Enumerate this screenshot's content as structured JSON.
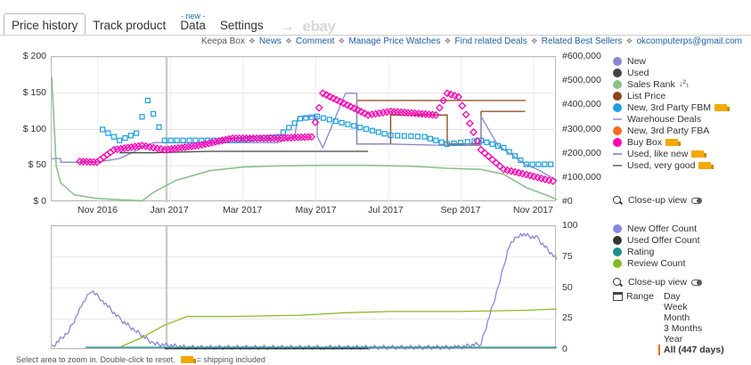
{
  "tabs": {
    "price_history": "Price history",
    "track_product": "Track product",
    "data_badge": "- new -",
    "data": "Data",
    "settings": "Settings",
    "arrow": "→",
    "ebay": "ebay"
  },
  "links": {
    "keepa_box": "Keepa Box",
    "news": "News",
    "comment": "Comment",
    "manage": "Manage Price Watches",
    "deals": "Find related Deals",
    "sellers": "Related Best Sellers",
    "email": "okcomputerps@gmail.com",
    "separator": "❖"
  },
  "top_legend": {
    "new": "New",
    "used": "Used",
    "sales_rank": "Sales Rank",
    "list_price": "List Price",
    "fbm": "New, 3rd Party FBM",
    "warehouse": "Warehouse Deals",
    "fba": "New, 3rd Party FBA",
    "buybox": "Buy Box",
    "like_new": "Used, like new",
    "very_good": "Used, very good",
    "sort_icon": "↓²₁",
    "closeup": "Close-up view"
  },
  "bottom_legend": {
    "new_offer": "New Offer Count",
    "used_offer": "Used Offer Count",
    "rating": "Rating",
    "review": "Review Count",
    "closeup": "Close-up view"
  },
  "range": {
    "label": "Range",
    "options": [
      "Day",
      "Week",
      "Month",
      "3 Months",
      "Year",
      "All (447 days)"
    ]
  },
  "footer": {
    "hint": "Select area to zoom in. Double-click to reset.",
    "shipping": "= shipping included"
  },
  "colors": {
    "new": "#8888cc",
    "used": "#444444",
    "sales_rank": "#8dc08d",
    "list_price": "#8b4513",
    "fbm": "#1a9fe0",
    "warehouse": "#b0a8e0",
    "fba": "#ff6a1a",
    "buybox": "#ff00b4",
    "like_new": "#9a9ad0",
    "very_good": "#888888",
    "new_offer": "#8888dd",
    "used_offer": "#333333",
    "rating": "#1a8f8f",
    "review": "#88bb22"
  },
  "chart_data": [
    {
      "type": "line",
      "title": "",
      "x_ticks": [
        "Nov 2016",
        "Jan 2017",
        "Mar 2017",
        "May 2017",
        "Jul 2017",
        "Sep 2017",
        "Nov 2017"
      ],
      "y_left_ticks": [
        "$ 200",
        "$ 150",
        "$ 100",
        "$ 50",
        "$ 0"
      ],
      "y_right_ticks": [
        "#600,000",
        "#500,000",
        "#400,000",
        "#300,000",
        "#200,000",
        "#100,000",
        "#0"
      ],
      "ylim_left": [
        0,
        200
      ],
      "ylim_right": [
        0,
        600000
      ],
      "x_domain_days": [
        0,
        447
      ],
      "series": [
        {
          "name": "List Price",
          "points": [
            [
              270,
              140
            ],
            [
              419,
              140
            ],
            [
              270,
              140
            ],
            [
              270,
              80
            ],
            [
              300,
              80
            ],
            [
              300,
              120
            ],
            [
              350,
              120
            ],
            [
              350,
              80
            ],
            [
              380,
              80
            ],
            [
              380,
              125
            ],
            [
              419,
              125
            ]
          ]
        },
        {
          "name": "New",
          "points": [
            [
              0,
              60
            ],
            [
              8,
              60
            ],
            [
              8,
              55
            ],
            [
              40,
              55
            ],
            [
              60,
              60
            ],
            [
              90,
              82
            ],
            [
              140,
              82
            ],
            [
              180,
              82
            ],
            [
              200,
              82
            ],
            [
              215,
              90
            ],
            [
              218,
              118
            ],
            [
              235,
              118
            ],
            [
              235,
              90
            ],
            [
              240,
              75
            ],
            [
              260,
              150
            ],
            [
              270,
              150
            ],
            [
              270,
              80
            ],
            [
              300,
              80
            ],
            [
              300,
              80
            ],
            [
              350,
              78
            ],
            [
              380,
              78
            ],
            [
              380,
              118
            ],
            [
              395,
              78
            ],
            [
              410,
              62
            ],
            [
              419,
              52
            ],
            [
              430,
              45
            ],
            [
              447,
              30
            ]
          ]
        },
        {
          "name": "Used",
          "points": [
            [
              60,
              68
            ],
            [
              90,
              68
            ],
            [
              140,
              70
            ],
            [
              200,
              70
            ],
            [
              250,
              70
            ],
            [
              280,
              70
            ]
          ]
        },
        {
          "name": "Sales Rank",
          "points": [
            [
              0,
              520000
            ],
            [
              4,
              150000
            ],
            [
              8,
              80000
            ],
            [
              20,
              30000
            ],
            [
              40,
              15000
            ],
            [
              60,
              10000
            ],
            [
              80,
              5000
            ],
            [
              90,
              40000
            ],
            [
              110,
              90000
            ],
            [
              140,
              130000
            ],
            [
              170,
              145000
            ],
            [
              200,
              150000
            ],
            [
              240,
              152000
            ],
            [
              280,
              152000
            ],
            [
              320,
              148000
            ],
            [
              350,
              140000
            ],
            [
              380,
              135000
            ],
            [
              400,
              115000
            ],
            [
              420,
              60000
            ],
            [
              440,
              25000
            ],
            [
              447,
              10000
            ]
          ]
        },
        {
          "name": "New, 3rd Party FBM",
          "points": [
            [
              45,
              100
            ],
            [
              60,
              85
            ],
            [
              75,
              95
            ],
            [
              85,
              140
            ],
            [
              100,
              85
            ],
            [
              160,
              85
            ],
            [
              200,
              90
            ],
            [
              220,
              115
            ],
            [
              235,
              118
            ],
            [
              300,
              92
            ],
            [
              330,
              90
            ],
            [
              350,
              80
            ],
            [
              380,
              85
            ],
            [
              400,
              75
            ],
            [
              420,
              52
            ],
            [
              447,
              52
            ]
          ]
        },
        {
          "name": "Buy Box",
          "points": [
            [
              25,
              56
            ],
            [
              40,
              55
            ],
            [
              55,
              72
            ],
            [
              80,
              78
            ],
            [
              100,
              72
            ],
            [
              130,
              78
            ],
            [
              160,
              88
            ],
            [
              200,
              88
            ],
            [
              230,
              90
            ],
            [
              240,
              150
            ],
            [
              280,
              120
            ],
            [
              300,
              125
            ],
            [
              340,
              120
            ],
            [
              350,
              150
            ],
            [
              360,
              145
            ],
            [
              380,
              72
            ],
            [
              400,
              45
            ],
            [
              420,
              38
            ],
            [
              440,
              30
            ],
            [
              447,
              28
            ]
          ]
        }
      ]
    },
    {
      "type": "line",
      "title": "",
      "x_domain_days": [
        0,
        447
      ],
      "y_right_ticks": [
        "100",
        "75",
        "50",
        "25",
        "0"
      ],
      "ylim": [
        0,
        100
      ],
      "series": [
        {
          "name": "New Offer Count",
          "points": [
            [
              0,
              2
            ],
            [
              15,
              15
            ],
            [
              28,
              38
            ],
            [
              35,
              48
            ],
            [
              45,
              40
            ],
            [
              60,
              25
            ],
            [
              75,
              15
            ],
            [
              90,
              5
            ],
            [
              120,
              2
            ],
            [
              240,
              2
            ],
            [
              360,
              2
            ],
            [
              380,
              5
            ],
            [
              395,
              50
            ],
            [
              405,
              85
            ],
            [
              415,
              94
            ],
            [
              430,
              90
            ],
            [
              447,
              73
            ]
          ]
        },
        {
          "name": "Used Offer Count",
          "points": [
            [
              100,
              1
            ],
            [
              160,
              1
            ],
            [
              220,
              1
            ],
            [
              280,
              1
            ]
          ]
        },
        {
          "name": "Rating",
          "points": [
            [
              30,
              2
            ],
            [
              447,
              2
            ]
          ]
        },
        {
          "name": "Review Count",
          "points": [
            [
              60,
              2
            ],
            [
              80,
              10
            ],
            [
              100,
              20
            ],
            [
              120,
              27
            ],
            [
              160,
              27
            ],
            [
              220,
              28
            ],
            [
              260,
              30
            ],
            [
              300,
              31
            ],
            [
              360,
              31
            ],
            [
              420,
              32
            ],
            [
              447,
              33
            ]
          ]
        }
      ]
    }
  ]
}
